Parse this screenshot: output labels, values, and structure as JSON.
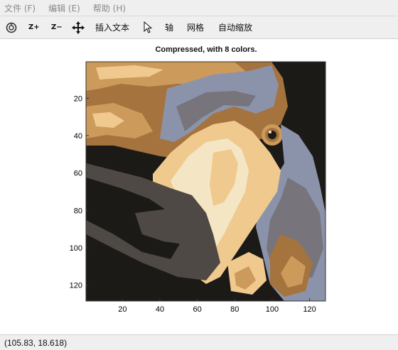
{
  "menu": [
    {
      "label": "文件 (F)"
    },
    {
      "label": "编辑 (E)"
    },
    {
      "label": "帮助 (H)"
    }
  ],
  "toolbar": {
    "zoom_in_label": "Z+",
    "zoom_out_label": "Z−",
    "insert_text_label": "插入文本",
    "axis_label": "轴",
    "grid_label": "网格",
    "autoscale_label": "自动缩放"
  },
  "figure": {
    "title": "Compressed, with 8 colors.",
    "x_ticks": [
      "20",
      "40",
      "60",
      "80",
      "100",
      "120"
    ],
    "y_ticks": [
      "20",
      "40",
      "60",
      "80",
      "100",
      "120"
    ]
  },
  "palette": [
    "#1c1a17",
    "#4f4945",
    "#77747c",
    "#8b93ab",
    "#a5733e",
    "#cc9a5b",
    "#f0c98f",
    "#f4e6c4"
  ],
  "status": {
    "coords": "(105.83, 18.618)"
  }
}
